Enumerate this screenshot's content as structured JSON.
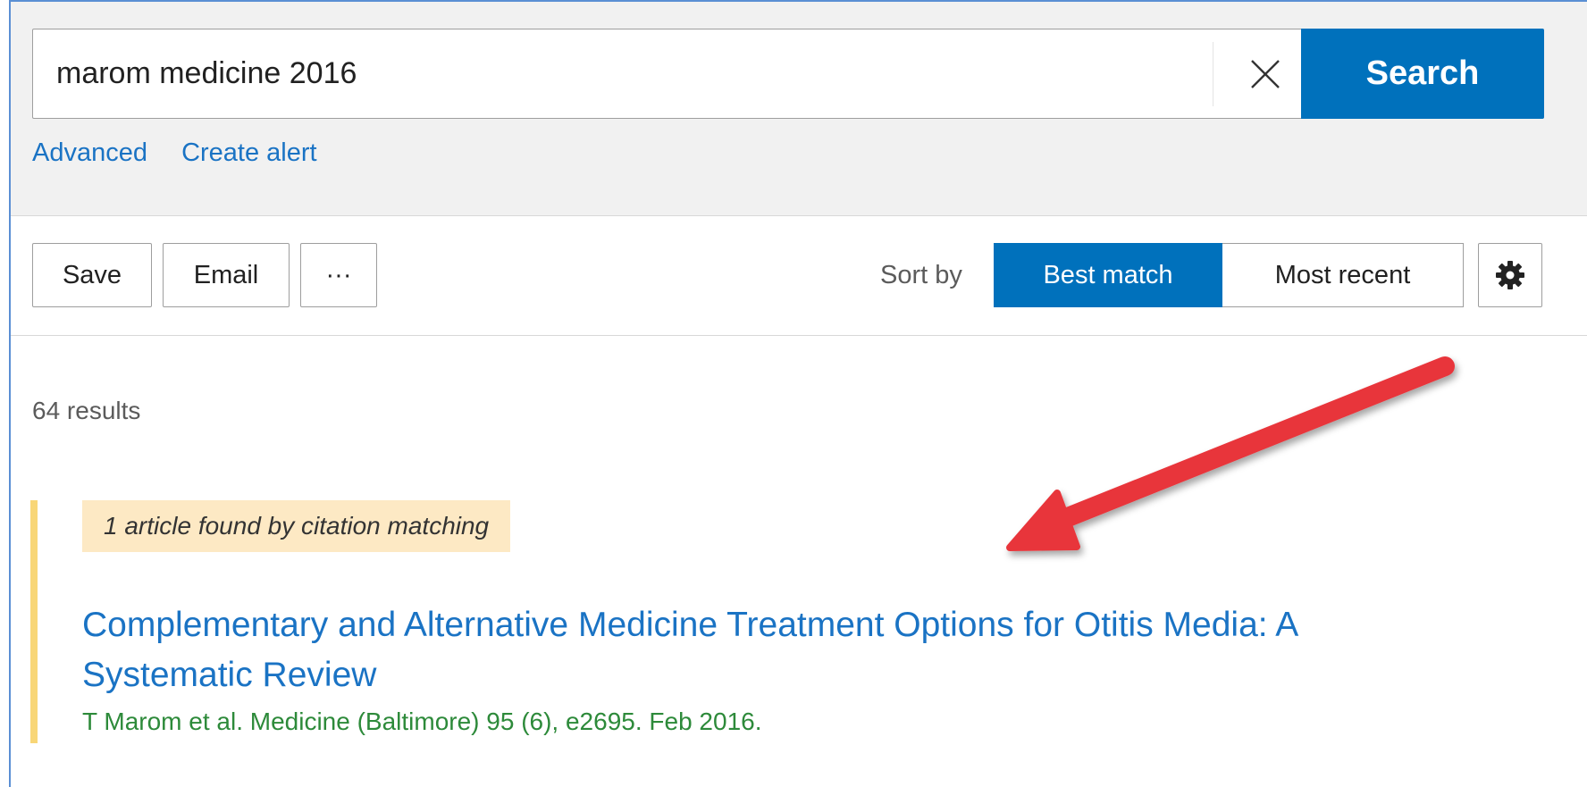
{
  "search": {
    "query": "marom medicine 2016",
    "button_label": "Search",
    "links": {
      "advanced": "Advanced",
      "create_alert": "Create alert"
    }
  },
  "toolbar": {
    "save_label": "Save",
    "email_label": "Email",
    "more_label": "···",
    "sort_by_label": "Sort by",
    "sort_options": [
      "Best match",
      "Most recent"
    ],
    "sort_selected": "Best match"
  },
  "results": {
    "count_text": "64 results",
    "citation_badge": "1 article found by citation matching",
    "items": [
      {
        "title": "Complementary and Alternative Medicine Treatment Options for Otitis Media: A Systematic Review",
        "citation": "T Marom et al. Medicine (Baltimore) 95 (6), e2695. Feb 2016."
      }
    ]
  },
  "icons": {
    "clear": "close-icon",
    "settings": "gear-icon",
    "annotation": "red-arrow"
  },
  "colors": {
    "accent": "#0071bc",
    "link": "#1a73c4",
    "citation_green": "#2d8a3a",
    "highlight_bar": "#f8d677",
    "badge_bg": "#fde9c4",
    "arrow": "#e8353b"
  }
}
